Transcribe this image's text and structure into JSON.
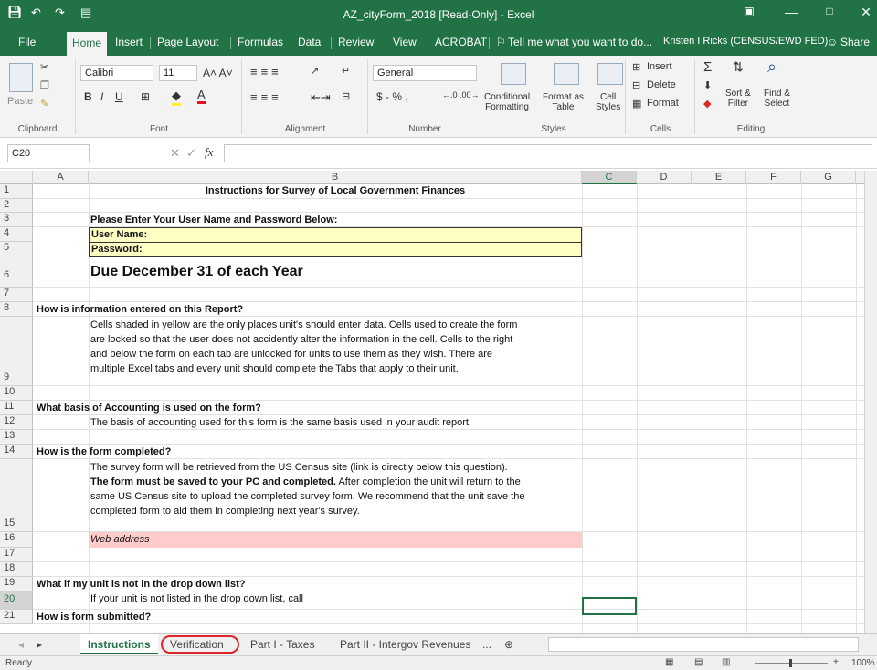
{
  "window": {
    "title": "AZ_cityForm_2018  [Read-Only] - Excel",
    "user": "Kristen I Ricks (CENSUS/EWD FED)",
    "share": "Share",
    "tell_me": "Tell me what you want to do..."
  },
  "ribbon_tabs": [
    "File",
    "Home",
    "Insert",
    "Page Layout",
    "Formulas",
    "Data",
    "Review",
    "View",
    "ACROBAT"
  ],
  "ribbon": {
    "clipboard": {
      "label": "Clipboard",
      "paste": "Paste"
    },
    "font": {
      "label": "Font",
      "name": "Calibri",
      "size": "11",
      "bold": "B",
      "italic": "I",
      "underline": "U"
    },
    "alignment": {
      "label": "Alignment"
    },
    "number": {
      "label": "Number",
      "format": "General",
      "currency": "$ - % ,"
    },
    "styles": {
      "label": "Styles",
      "conditional": "Conditional\nFormatting",
      "format_table": "Format as\nTable",
      "cell_styles": "Cell\nStyles"
    },
    "cells": {
      "label": "Cells",
      "insert": "Insert",
      "delete": "Delete",
      "format": "Format"
    },
    "editing": {
      "label": "Editing",
      "sort": "Sort &\nFilter",
      "find": "Find &\nSelect"
    }
  },
  "formula_bar": {
    "name_box": "C20",
    "fx": "fx",
    "value": ""
  },
  "columns": [
    "A",
    "B",
    "C",
    "D",
    "E",
    "F",
    "G"
  ],
  "rows": [
    "1",
    "2",
    "3",
    "4",
    "5",
    "6",
    "7",
    "8",
    "9",
    "10",
    "11",
    "12",
    "13",
    "14",
    "15",
    "16",
    "17",
    "18",
    "19",
    "20",
    "21"
  ],
  "cells": {
    "b1": "Instructions for Survey of Local Government Finances",
    "b3": "Please  Enter Your User Name and Password Below:",
    "b4": "User Name:",
    "b5": "Password:",
    "b6": "Due December 31 of each Year",
    "a8": "How is information entered on this Report?",
    "b9_1": "Cells shaded in yellow are the only places unit's should enter data.  Cells used to create the form",
    "b9_2": "are locked so that the user does not accidently alter the information in the cell.  Cells to the right",
    "b9_3": "and below the form on each tab are unlocked for units to use them as they wish.  There are",
    "b9_4": "multiple Excel tabs and every unit should complete the Tabs that apply to their unit.",
    "a11": "What basis of Accounting is used on the form?",
    "b12": "The basis of accounting used for this form is the same basis used in your audit report.",
    "a14": "How is the form completed?",
    "b15_1": "The survey form will be retrieved from the US Census site (link is directly below this question).",
    "b15_2a": "The form must be saved to your PC and completed.",
    "b15_2b": "  After completion the unit will return to the",
    "b15_3": "same US Census site to upload the completed survey form.  We recommend that the unit save the",
    "b15_4": "completed form to aid them in completing next year's survey.",
    "b16": "Web address",
    "a18": "What if my unit is not in the drop down list?",
    "b19": "If your unit is not listed in the drop down list, call",
    "a21": "How is form submitted?"
  },
  "sheets": [
    "Instructions",
    "Verification",
    "Part I - Taxes",
    "Part II - Intergov Revenues",
    "..."
  ],
  "status": {
    "ready": "Ready",
    "zoom": "100%"
  },
  "colors": {
    "accent": "#217346",
    "yellow_fill": "#ffffc5",
    "pink_fill": "#ffcccc",
    "highlight_ring": "#d9272d"
  }
}
